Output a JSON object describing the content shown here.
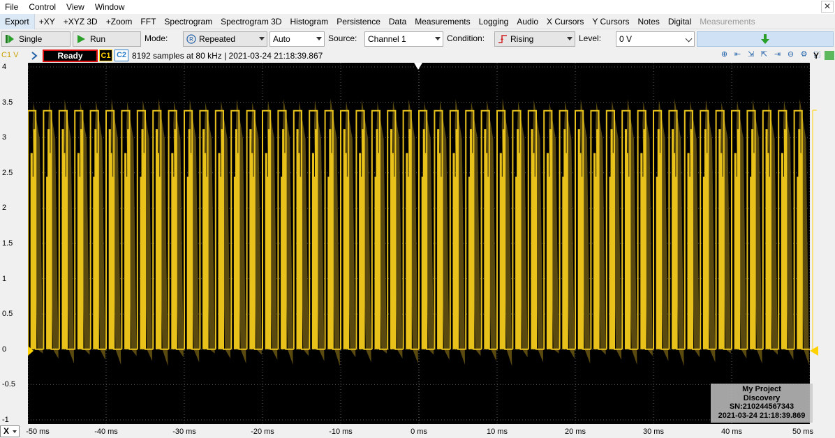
{
  "menu": [
    "File",
    "Control",
    "View",
    "Window"
  ],
  "tools": [
    "Export",
    "+XY",
    "+XYZ 3D",
    "+Zoom",
    "FFT",
    "Spectrogram",
    "Spectrogram 3D",
    "Histogram",
    "Persistence",
    "Data",
    "Measurements",
    "Logging",
    "Audio",
    "X Cursors",
    "Y Cursors",
    "Notes",
    "Digital",
    "Measurements"
  ],
  "controls": {
    "single_label": "Single",
    "run_label": "Run",
    "mode_label": "Mode:",
    "mode_value": "Repeated",
    "auto_value": "Auto",
    "source_label": "Source:",
    "source_value": "Channel 1",
    "condition_label": "Condition:",
    "condition_value": "Rising",
    "level_label": "Level:",
    "level_value": "0 V"
  },
  "status": {
    "channel_unit": "C1 V",
    "state": "Ready",
    "c1": "C1",
    "c2": "C2",
    "samples_info": "8192 samples at 80 kHz | 2021-03-24 21:18:39.867",
    "y_unit": "Y"
  },
  "axes": {
    "y_ticks": [
      "4",
      "3.5",
      "3",
      "2.5",
      "2",
      "1.5",
      "1",
      "0.5",
      "0",
      "-0.5",
      "-1"
    ],
    "y_values": [
      4,
      3.5,
      3,
      2.5,
      2,
      1.5,
      1,
      0.5,
      0,
      -0.5,
      -1
    ],
    "x_ticks": [
      "-50 ms",
      "-40 ms",
      "-30 ms",
      "-20 ms",
      "-10 ms",
      "0 ms",
      "10 ms",
      "20 ms",
      "30 ms",
      "40 ms",
      "50 ms"
    ],
    "x_values": [
      -50,
      -40,
      -30,
      -20,
      -10,
      0,
      10,
      20,
      30,
      40,
      50
    ],
    "x_button": "X"
  },
  "signal": {
    "high_v": 3.38,
    "low_v": 0,
    "color": "#e8c21a",
    "envelope_color": "#5a4a10",
    "cycles": 50
  },
  "watermark": {
    "project": "My Project",
    "device": "Discovery",
    "serial": "SN:210244567343",
    "timestamp": "2021-03-24 21:18:39.869"
  }
}
